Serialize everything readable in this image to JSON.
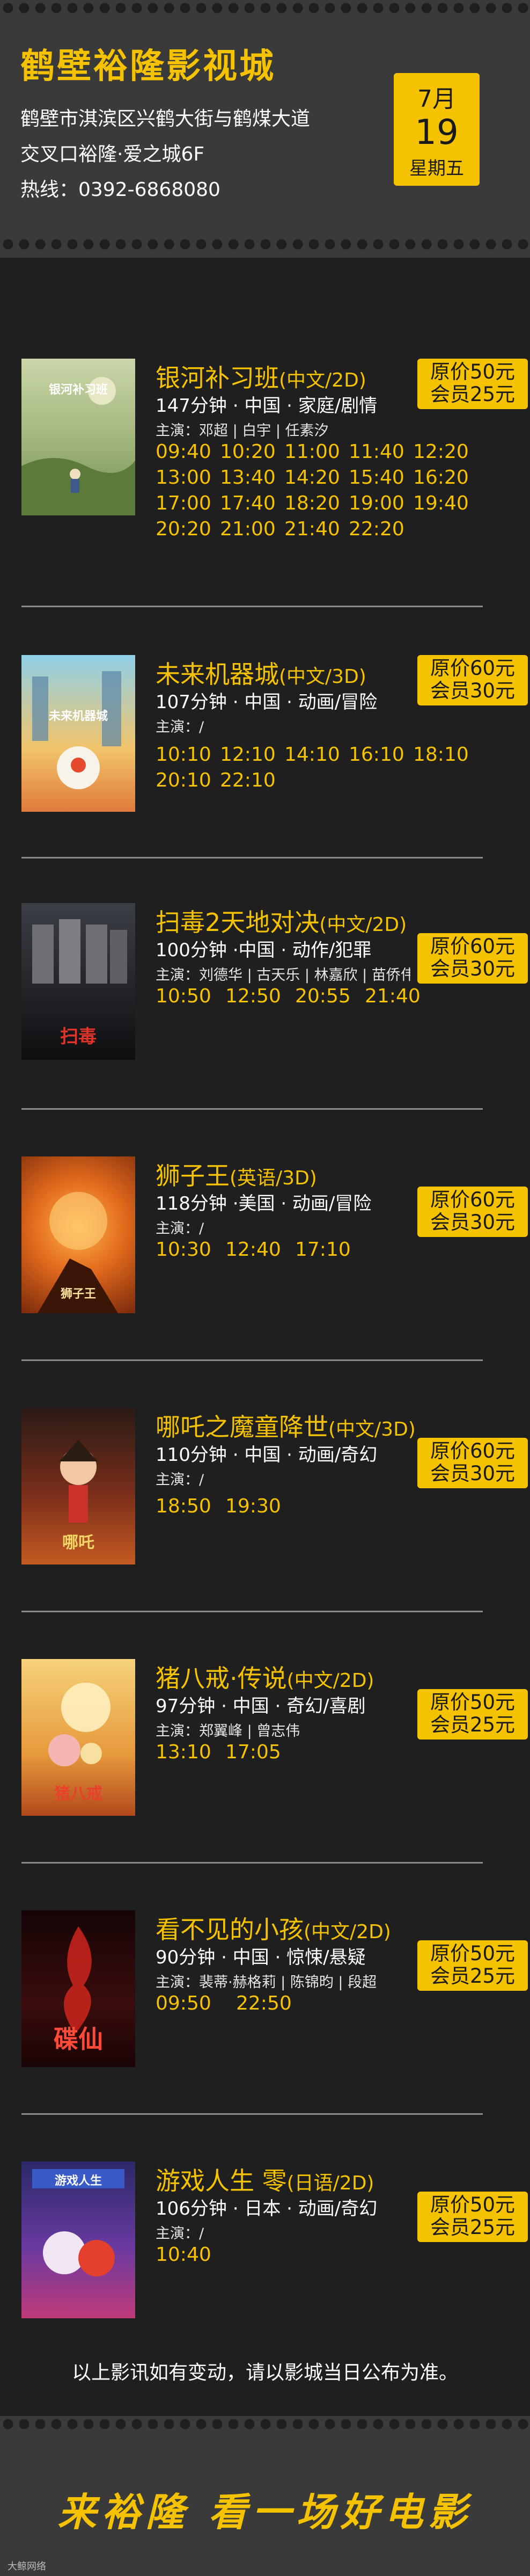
{
  "header": {
    "cinema_name": "鹤壁裕隆影视城",
    "address_line1": "鹤壁市淇滨区兴鹤大街与鹤煤大道",
    "address_line2": "交叉口裕隆·爱之城6F",
    "hotline": "热线：0392-6868080",
    "date": {
      "month": "7月",
      "day": "19",
      "weekday": "星期五"
    }
  },
  "colors": {
    "accent": "#f5c200",
    "background": "#1f1f1f",
    "band": "#3a3a3a"
  },
  "movies": [
    {
      "title": "银河补习班",
      "lang": "(中文/2D)",
      "meta": "147分钟 · 中国 · 家庭/剧情",
      "cast": "主演：邓超 | 白宇 | 任素汐",
      "times": [
        "09:40",
        "10:20",
        "11:00",
        "11:40",
        "12:20",
        "13:00",
        "13:40",
        "14:20",
        "15:40",
        "16:20",
        "17:00",
        "17:40",
        "18:20",
        "19:00",
        "19:40",
        "20:20",
        "21:00",
        "21:40",
        "22:20"
      ],
      "price_original": "原价50元",
      "price_member": "会员25元",
      "poster_text": "银河补习班"
    },
    {
      "title": "未来机器城",
      "lang": "(中文/3D)",
      "meta": "107分钟 · 中国 · 动画/冒险",
      "cast": "主演：/",
      "times": [
        "10:10",
        "12:10",
        "14:10",
        "16:10",
        "18:10",
        "20:10",
        "22:10"
      ],
      "price_original": "原价60元",
      "price_member": "会员30元",
      "poster_text": "未来机器城"
    },
    {
      "title": "扫毒2天地对决",
      "lang": "(中文/2D)",
      "meta": "100分钟 ·中国 · 动作/犯罪",
      "cast": "主演：刘德华 | 古天乐 | 林嘉欣 | 苗侨伟",
      "times": [
        "10:50",
        "12:50",
        "20:55",
        "21:40"
      ],
      "price_original": "原价60元",
      "price_member": "会员30元",
      "poster_text": "扫毒"
    },
    {
      "title": "狮子王",
      "lang": "(英语/3D)",
      "meta": "118分钟 ·美国 · 动画/冒险",
      "cast": "主演：/",
      "times": [
        "10:30",
        "12:40",
        "17:10"
      ],
      "price_original": "原价60元",
      "price_member": "会员30元",
      "poster_text": "狮子王"
    },
    {
      "title": "哪吒之魔童降世",
      "lang": "(中文/3D)",
      "meta": "110分钟 · 中国 · 动画/奇幻",
      "cast": "主演：/",
      "times": [
        "18:50",
        "19:30"
      ],
      "price_original": "原价60元",
      "price_member": "会员30元",
      "poster_text": "哪吒"
    },
    {
      "title": "猪八戒·传说",
      "lang": "(中文/2D)",
      "meta": "97分钟 · 中国 · 奇幻/喜剧",
      "cast": "主演：郑翼峰 | 曾志伟",
      "times": [
        "13:10",
        "17:05"
      ],
      "price_original": "原价50元",
      "price_member": "会员25元",
      "poster_text": "猪八戒"
    },
    {
      "title": "看不见的小孩",
      "lang": "(中文/2D)",
      "meta": "90分钟 · 中国 · 惊悚/悬疑",
      "cast": "主演：裴蒂·赫格莉 | 陈锦昀 | 段超",
      "times": [
        "09:50",
        "22:50"
      ],
      "price_original": "原价50元",
      "price_member": "会员25元",
      "poster_text": "碟仙"
    },
    {
      "title": "游戏人生 零",
      "lang": "(日语/2D)",
      "meta": "106分钟 · 日本 · 动画/奇幻",
      "cast": "主演：/",
      "times": [
        "10:40"
      ],
      "price_original": "原价50元",
      "price_member": "会员25元",
      "poster_text": "游戏人生"
    }
  ],
  "notice": "以上影讯如有变动，请以影城当日公布为准。",
  "slogan": "来裕隆 看一场好电影",
  "watermark": "大鲸网络"
}
